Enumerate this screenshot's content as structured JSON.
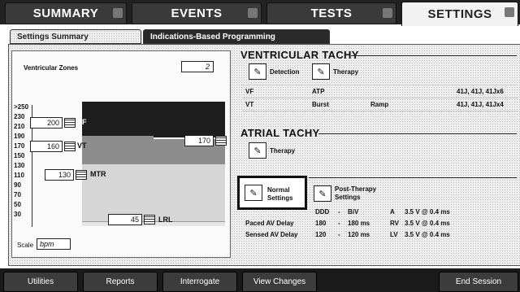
{
  "top_tabs": [
    {
      "label": "SUMMARY"
    },
    {
      "label": "EVENTS"
    },
    {
      "label": "TESTS"
    },
    {
      "label": "SETTINGS"
    }
  ],
  "sub_tabs": [
    {
      "label": "Settings Summary"
    },
    {
      "label": "Indications-Based Programming"
    }
  ],
  "left": {
    "zones_label": "Ventricular Zones",
    "zones_value": "2",
    "ticks": [
      ">250",
      "230",
      "210",
      "190",
      "170",
      "150",
      "130",
      "110",
      "90",
      "70",
      "50",
      "30"
    ],
    "vf_rate": "200",
    "vf_label": "VF",
    "vt_rate": "160",
    "vt_label": "VT",
    "mtr_rate": "130",
    "mtr_label": "MTR",
    "vt_right_rate": "170",
    "lrl_rate": "45",
    "lrl_label": "LRL",
    "scale_label": "Scale",
    "scale_value": "bpm"
  },
  "right": {
    "vtachy_title": "VENTRICULAR TACHY",
    "detection_label": "Detection",
    "therapy_label": "Therapy",
    "rows": [
      {
        "zone": "VF",
        "therapy": "ATP",
        "mode": "",
        "shocks": "41J, 41J, 41Jx6"
      },
      {
        "zone": "VT",
        "therapy": "Burst",
        "mode": "Ramp",
        "shocks": "41J, 41J, 41Jx4"
      }
    ],
    "atachy_title": "ATRIAL TACHY",
    "atrial_therapy_label": "Therapy",
    "normal_label_1": "Normal",
    "normal_label_2": "Settings",
    "post_label_1": "Post-Therapy",
    "post_label_2": "Settings",
    "brady_rows": [
      {
        "name": "",
        "value": "DDD",
        "sep": "-",
        "value2": "BiV",
        "lead": "A",
        "amp": "3.5 V @ 0.4 ms"
      },
      {
        "name": "Paced AV Delay",
        "value": "180",
        "sep": "-",
        "value2": "180 ms",
        "lead": "RV",
        "amp": "3.5 V @ 0.4 ms"
      },
      {
        "name": "Sensed AV Delay",
        "value": "120",
        "sep": "-",
        "value2": "120 ms",
        "lead": "LV",
        "amp": "3.5 V @ 0.4 ms"
      }
    ]
  },
  "bottom_buttons": [
    {
      "label": "Utilities"
    },
    {
      "label": "Reports"
    },
    {
      "label": "Interrogate"
    },
    {
      "label": "View Changes"
    },
    {
      "label": "End Session"
    }
  ]
}
